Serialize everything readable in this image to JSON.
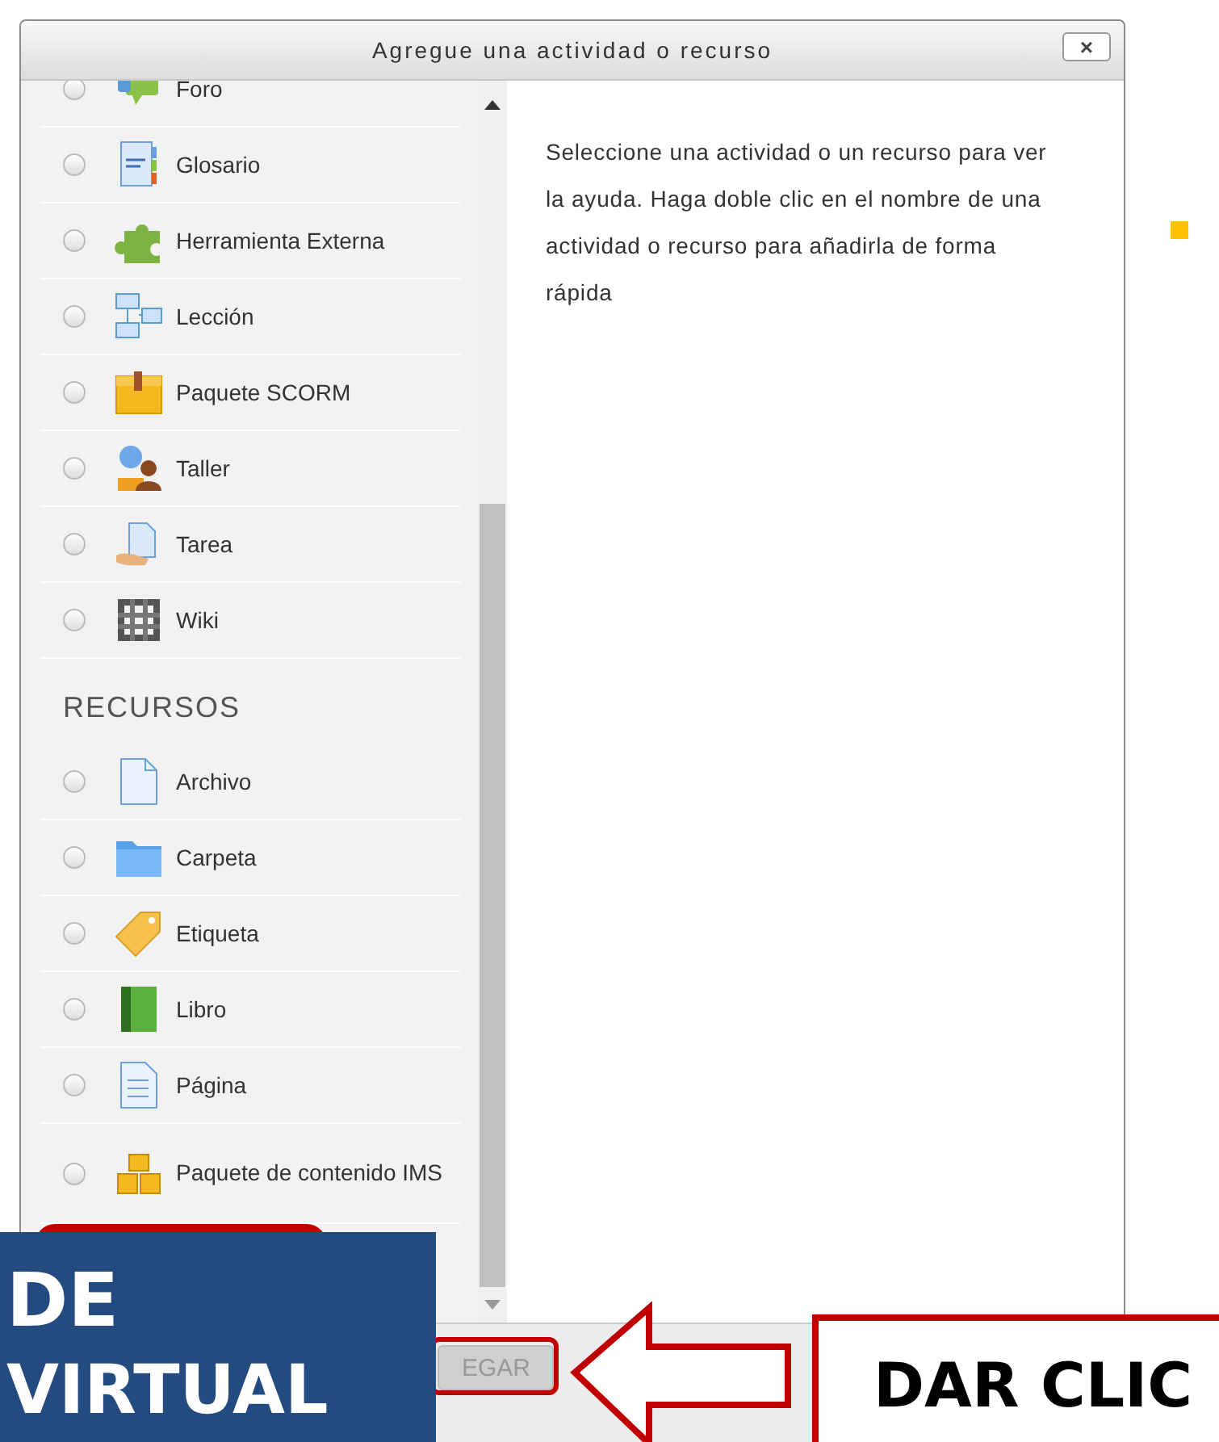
{
  "dialog": {
    "title": "Agregue una actividad o recurso",
    "close_label": "×",
    "activities": [
      {
        "label": "Foro",
        "selected": false
      },
      {
        "label": "Glosario",
        "selected": false
      },
      {
        "label": "Herramienta Externa",
        "selected": false
      },
      {
        "label": "Lección",
        "selected": false
      },
      {
        "label": "Paquete SCORM",
        "selected": false
      },
      {
        "label": "Taller",
        "selected": false
      },
      {
        "label": "Tarea",
        "selected": false
      },
      {
        "label": "Wiki",
        "selected": false
      }
    ],
    "resources_heading": "RECURSOS",
    "resources": [
      {
        "label": "Archivo",
        "selected": false
      },
      {
        "label": "Carpeta",
        "selected": false
      },
      {
        "label": "Etiqueta",
        "selected": false
      },
      {
        "label": "Libro",
        "selected": false
      },
      {
        "label": "Página",
        "selected": false
      },
      {
        "label": "Paquete de contenido IMS",
        "selected": false
      }
    ],
    "help_text": "Seleccione una actividad o un recurso para ver la ayuda. Haga doble clic en el nombre de una actividad o recurso para añadirla de forma rápida",
    "add_button": "EGAR"
  },
  "annotations": {
    "banner_lines": [
      "DE",
      "VIRTUAL"
    ],
    "callout": "DAR CLIC"
  }
}
